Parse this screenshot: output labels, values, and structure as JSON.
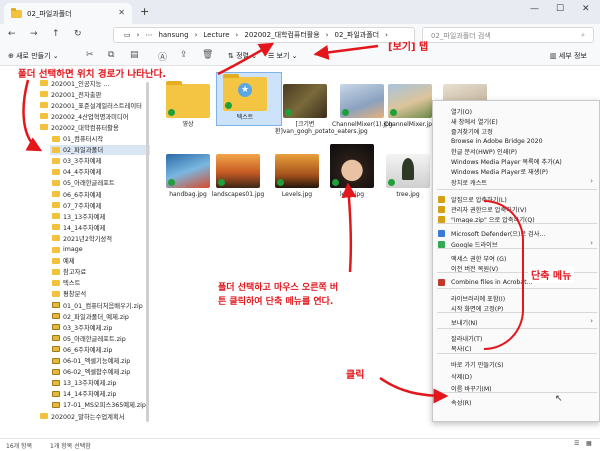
{
  "window": {
    "tab_title": "02_파일과폴더",
    "new_tab_icon": "plus-icon",
    "buttons": [
      "minimize-icon",
      "maximize-icon",
      "close-icon"
    ]
  },
  "addressbar": {
    "crumbs": [
      "hansung",
      "Lecture",
      "202002_대학컴퓨터활용",
      "02_파일과폴더"
    ],
    "search_placeholder": "02_파일과폴더 검색"
  },
  "toolbar": {
    "new_label": "새로 만들기",
    "sort_label": "정렬",
    "view_label": "보기",
    "details_label": "세부 정보"
  },
  "nav_items": [
    {
      "label": "202001_인공지능 ...",
      "icon": "folder"
    },
    {
      "label": "202001_전자출판",
      "icon": "folder"
    },
    {
      "label": "202001_표준설계일러스트레이터",
      "icon": "folder"
    },
    {
      "label": "202002_4산업혁명과미디어",
      "icon": "folder"
    },
    {
      "label": "202002_대학컴퓨터활용",
      "icon": "folder"
    },
    {
      "label": "01_컴퓨터시작",
      "icon": "folder"
    },
    {
      "label": "02_파일과폴더",
      "icon": "folder",
      "selected": true
    },
    {
      "label": "03_3주차예제",
      "icon": "folder"
    },
    {
      "label": "04_4주차예제",
      "icon": "folder"
    },
    {
      "label": "05_아래한글레포트",
      "icon": "folder"
    },
    {
      "label": "06_6주차예제",
      "icon": "folder"
    },
    {
      "label": "07_7주차예제",
      "icon": "folder"
    },
    {
      "label": "13_13주차예제",
      "icon": "folder"
    },
    {
      "label": "14_14주차예제",
      "icon": "folder"
    },
    {
      "label": "2021년2학기성적",
      "icon": "folder"
    },
    {
      "label": "image",
      "icon": "folder"
    },
    {
      "label": "예제",
      "icon": "folder"
    },
    {
      "label": "참고자료",
      "icon": "folder"
    },
    {
      "label": "텍스트",
      "icon": "folder"
    },
    {
      "label": "평창분석",
      "icon": "folder"
    },
    {
      "label": "01_01_컴퓨터처음배우기.zip",
      "icon": "zip"
    },
    {
      "label": "02_파일과폴더_예제.zip",
      "icon": "zip"
    },
    {
      "label": "03_3주차예제.zip",
      "icon": "zip"
    },
    {
      "label": "05_아래한글레포트.zip",
      "icon": "zip"
    },
    {
      "label": "06_6주차예제.zip",
      "icon": "zip"
    },
    {
      "label": "06-01_엑셀기능예제.zip",
      "icon": "zip"
    },
    {
      "label": "06-02_엑셀함수예제.zip",
      "icon": "zip"
    },
    {
      "label": "13_13주차예제.zip",
      "icon": "zip"
    },
    {
      "label": "14_14주차예제.zip",
      "icon": "zip"
    },
    {
      "label": "17-01_MS오피스365예제.zip",
      "icon": "zip"
    },
    {
      "label": "202002_말하는수업계획서",
      "icon": "folder"
    }
  ],
  "files": [
    {
      "label": "영상",
      "kind": "folder"
    },
    {
      "label": "텍스트",
      "kind": "folder",
      "selected": true
    },
    {
      "label": "[크기변환]van_gogh_potato_eaters.jpg",
      "kind": "image"
    },
    {
      "label": "ChannelMixer(1).jpg",
      "kind": "image"
    },
    {
      "label": "ChannelMixer.jpg",
      "kind": "image"
    },
    {
      "label": "handbag.jpg",
      "kind": "image"
    },
    {
      "label": "landscapes01.jpg",
      "kind": "image"
    },
    {
      "label": "Levels.jpg",
      "kind": "image"
    },
    {
      "label": "lena.jpg",
      "kind": "image"
    },
    {
      "label": "tree.jpg",
      "kind": "image"
    }
  ],
  "context_menu": {
    "items": [
      "열기(O)",
      "새 창에서 열기(E)",
      "즐겨찾기에 고정",
      "Browse in Adobe Bridge 2020",
      "한글 문서(HWP) 인쇄(P)",
      "Windows Media Player 목록에 추가(A)",
      "Windows Media Player로 재생(P)",
      "장치로 캐스트",
      "알집으로 압축하기(L)",
      "관리자 권한으로 압축하기(V)",
      "\"image.zip\" 으로 압축하기(Q)",
      "Microsoft Defender(으)로 검사...",
      "Google 드라이브",
      "액세스 권한 부여 (G)",
      "이전 버전 복원(V)",
      "Combine files in Acrobat...",
      "라이브러리에 포함(I)",
      "시작 화면에 고정(P)",
      "보내기(N)",
      "잘라내기(T)",
      "복사(C)",
      "바로 가기 만들기(S)",
      "삭제(D)",
      "이름 바꾸기(M)",
      "속성(R)"
    ]
  },
  "status": {
    "count": "16개 항목",
    "selected": "1개 항목 선택함"
  },
  "annotations": {
    "view_tab": "[보기] 탭",
    "path_note": "폴더 선택하면 위치 경로가 나타난다.",
    "right_click_line1": "폴더 선택하고 마우스 오른쪽 버",
    "right_click_line2": "튼 클릭하여  단축 메뉴를 연다.",
    "shortcut_menu": "단축 메뉴",
    "click": "클릭"
  },
  "colors": {
    "annotation": "#e3161c",
    "folder": "#f4c543",
    "selection": "#cde3fa"
  }
}
